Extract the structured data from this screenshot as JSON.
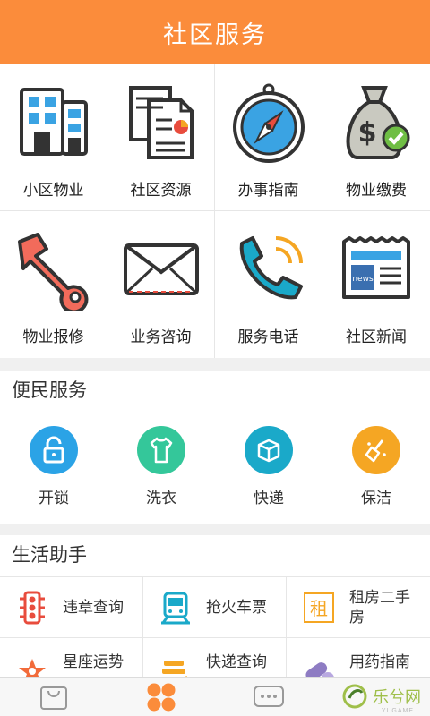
{
  "header": {
    "title": "社区服务"
  },
  "grid": [
    {
      "label": "小区物业",
      "icon": "building-icon"
    },
    {
      "label": "社区资源",
      "icon": "documents-icon"
    },
    {
      "label": "办事指南",
      "icon": "compass-icon"
    },
    {
      "label": "物业缴费",
      "icon": "money-bag-icon"
    },
    {
      "label": "物业报修",
      "icon": "wrench-icon"
    },
    {
      "label": "业务咨询",
      "icon": "envelope-icon"
    },
    {
      "label": "服务电话",
      "icon": "phone-icon"
    },
    {
      "label": "社区新闻",
      "icon": "newspaper-icon"
    }
  ],
  "convenience": {
    "title": "便民服务",
    "items": [
      {
        "label": "开锁",
        "icon": "lock-icon",
        "color": "#2ba3e6"
      },
      {
        "label": "洗衣",
        "icon": "shirt-icon",
        "color": "#34c79a"
      },
      {
        "label": "快递",
        "icon": "package-icon",
        "color": "#1aa9c9"
      },
      {
        "label": "保洁",
        "icon": "broom-icon",
        "color": "#f5a623"
      }
    ]
  },
  "life": {
    "title": "生活助手",
    "items": [
      {
        "label": "违章查询",
        "icon": "traffic-light-icon"
      },
      {
        "label": "抢火车票",
        "icon": "train-icon"
      },
      {
        "label": "租房二手房",
        "icon": "rent-icon",
        "badge": "租"
      },
      {
        "label": "星座运势",
        "icon": "star-sign-icon"
      },
      {
        "label": "快递查询",
        "icon": "delivery-icon"
      },
      {
        "label": "用药指南",
        "icon": "pill-icon"
      }
    ]
  },
  "tabbar": {
    "items": [
      {
        "icon": "shopping-bag-icon"
      },
      {
        "icon": "grid-dots-icon",
        "active": true
      },
      {
        "icon": "chat-bubble-icon"
      }
    ]
  },
  "watermark": {
    "text": "乐兮网",
    "sub": "YI GAME"
  },
  "colors": {
    "header": "#fb8c3b",
    "accent": "#fb8c3b"
  }
}
